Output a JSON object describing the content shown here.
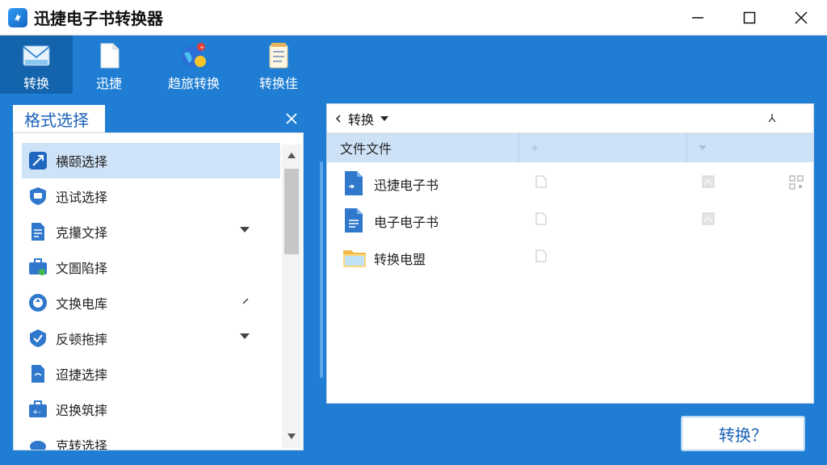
{
  "app": {
    "title": "迅捷电子书转换器"
  },
  "toolbar": {
    "items": [
      {
        "label": "转换",
        "icon": "envelope-icon",
        "active": true
      },
      {
        "label": "迅捷",
        "icon": "document-icon",
        "active": false
      },
      {
        "label": "趋旅转换",
        "icon": "globe-icon",
        "active": false
      },
      {
        "label": "转换佳",
        "icon": "notepad-icon",
        "active": false
      }
    ]
  },
  "left": {
    "tab_title": "格式选择",
    "items": [
      {
        "label": "横颐选择",
        "icon": "arrow-icon",
        "selected": true
      },
      {
        "label": "迅试选择",
        "icon": "shield-chat-icon"
      },
      {
        "label": "克攥文择",
        "icon": "document-icon",
        "expandable": true
      },
      {
        "label": "文圄陷择",
        "icon": "toolbox-icon"
      },
      {
        "label": "文换电库",
        "icon": "refresh-icon",
        "expandable": true
      },
      {
        "label": "反顿拖摔",
        "icon": "check-badge-icon",
        "expandable": true
      },
      {
        "label": "迢捷选摔",
        "icon": "page-icon"
      },
      {
        "label": "迟换筑摔",
        "icon": "briefcase-icon"
      },
      {
        "label": "克转选择",
        "icon": "cloud-icon"
      }
    ]
  },
  "right": {
    "breadcrumb": "转换",
    "columns": [
      "文件文件"
    ],
    "files": [
      {
        "name": "迅捷电子书",
        "type": "ebook"
      },
      {
        "name": "电子电子书",
        "type": "ebook"
      },
      {
        "name": "转换电盟",
        "type": "folder"
      }
    ]
  },
  "actions": {
    "convert_label": "转换？"
  },
  "colors": {
    "accent": "#1f7ed4",
    "selection": "#cfe3f8",
    "header": "#cde2f7"
  }
}
